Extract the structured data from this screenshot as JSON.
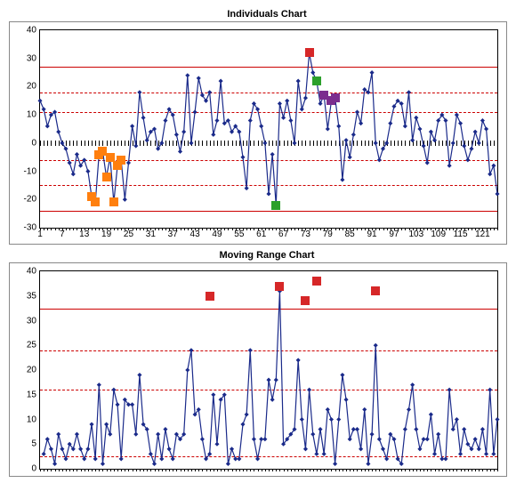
{
  "chart_data": [
    {
      "id": "individuals",
      "title": "Individuals Chart",
      "type": "line",
      "xlabel": "",
      "ylabel": "",
      "xlim": [
        1,
        125
      ],
      "ylim": [
        -30,
        40
      ],
      "y_ticks": [
        -30,
        -20,
        -10,
        0,
        10,
        20,
        30,
        40
      ],
      "x_ticks": [
        1,
        7,
        13,
        19,
        25,
        31,
        37,
        43,
        49,
        55,
        61,
        67,
        73,
        79,
        85,
        91,
        97,
        103,
        109,
        115,
        121
      ],
      "ref_lines": {
        "solid": [
          27,
          -24
        ],
        "dashed": [
          18,
          11,
          -6,
          -15
        ]
      },
      "zero_axis": 0,
      "series": [
        {
          "name": "individuals",
          "color": "#1a2a8a",
          "x": [
            1,
            2,
            3,
            4,
            5,
            6,
            7,
            8,
            9,
            10,
            11,
            12,
            13,
            14,
            15,
            16,
            17,
            18,
            19,
            20,
            21,
            22,
            23,
            24,
            25,
            26,
            27,
            28,
            29,
            30,
            31,
            32,
            33,
            34,
            35,
            36,
            37,
            38,
            39,
            40,
            41,
            42,
            43,
            44,
            45,
            46,
            47,
            48,
            49,
            50,
            51,
            52,
            53,
            54,
            55,
            56,
            57,
            58,
            59,
            60,
            61,
            62,
            63,
            64,
            65,
            66,
            67,
            68,
            69,
            70,
            71,
            72,
            73,
            74,
            75,
            76,
            77,
            78,
            79,
            80,
            81,
            82,
            83,
            84,
            85,
            86,
            87,
            88,
            89,
            90,
            91,
            92,
            93,
            94,
            95,
            96,
            97,
            98,
            99,
            100,
            101,
            102,
            103,
            104,
            105,
            106,
            107,
            108,
            109,
            110,
            111,
            112,
            113,
            114,
            115,
            116,
            117,
            118,
            119,
            120,
            121,
            122,
            123,
            124,
            125
          ],
          "values": [
            15,
            12,
            6,
            10,
            11,
            4,
            0,
            -2,
            -7,
            -11,
            -4,
            -8,
            -6,
            -10,
            -19,
            -21,
            -4,
            -3,
            -12,
            -5,
            -21,
            -8,
            -6,
            -20,
            -7,
            6,
            -1,
            18,
            9,
            1,
            4,
            5,
            -2,
            0,
            8,
            12,
            10,
            3,
            -3,
            4,
            24,
            0,
            11,
            23,
            17,
            15,
            18,
            3,
            8,
            22,
            7,
            8,
            4,
            6,
            4,
            -5,
            -16,
            8,
            14,
            12,
            6,
            0,
            -18,
            -4,
            -22,
            14,
            9,
            15,
            8,
            0,
            22,
            12,
            16,
            32,
            25,
            22,
            14,
            17,
            5,
            15,
            16,
            6,
            -13,
            1,
            -5,
            3,
            11,
            7,
            19,
            18,
            25,
            0,
            -6,
            -2,
            0,
            7,
            13,
            15,
            14,
            6,
            18,
            1,
            9,
            5,
            -1,
            -7,
            4,
            1,
            8,
            10,
            8,
            -8,
            0,
            10,
            7,
            -1,
            -6,
            -2,
            4,
            0,
            8,
            5,
            -11,
            -8,
            -18
          ]
        }
      ],
      "highlight_markers": [
        {
          "x": 15,
          "y": -19,
          "color": "orange"
        },
        {
          "x": 16,
          "y": -21,
          "color": "orange"
        },
        {
          "x": 17,
          "y": -4,
          "color": "orange"
        },
        {
          "x": 18,
          "y": -3,
          "color": "orange"
        },
        {
          "x": 19,
          "y": -12,
          "color": "orange"
        },
        {
          "x": 20,
          "y": -5,
          "color": "orange"
        },
        {
          "x": 21,
          "y": -21,
          "color": "orange"
        },
        {
          "x": 22,
          "y": -8,
          "color": "orange"
        },
        {
          "x": 23,
          "y": -6,
          "color": "orange"
        },
        {
          "x": 65,
          "y": -22,
          "color": "green"
        },
        {
          "x": 74,
          "y": 32,
          "color": "red"
        },
        {
          "x": 76,
          "y": 22,
          "color": "green"
        },
        {
          "x": 78,
          "y": 17,
          "color": "purple"
        },
        {
          "x": 80,
          "y": 15,
          "color": "purple"
        },
        {
          "x": 81,
          "y": 16,
          "color": "purple"
        }
      ]
    },
    {
      "id": "moving_range",
      "title": "Moving Range Chart",
      "type": "line",
      "xlabel": "",
      "ylabel": "",
      "xlim": [
        1,
        125
      ],
      "ylim": [
        0,
        40
      ],
      "y_ticks": [
        0,
        5,
        10,
        15,
        20,
        25,
        30,
        35,
        40
      ],
      "x_ticks_minor_only": true,
      "ref_lines": {
        "solid": [
          32.5
        ],
        "dashed": [
          24,
          16,
          2.5
        ]
      },
      "series": [
        {
          "name": "moving_range",
          "color": "#1a2a8a",
          "x": [
            2,
            3,
            4,
            5,
            6,
            7,
            8,
            9,
            10,
            11,
            12,
            13,
            14,
            15,
            16,
            17,
            18,
            19,
            20,
            21,
            22,
            23,
            24,
            25,
            26,
            27,
            28,
            29,
            30,
            31,
            32,
            33,
            34,
            35,
            36,
            37,
            38,
            39,
            40,
            41,
            42,
            43,
            44,
            45,
            46,
            47,
            48,
            49,
            50,
            51,
            52,
            53,
            54,
            55,
            56,
            57,
            58,
            59,
            60,
            61,
            62,
            63,
            64,
            65,
            66,
            67,
            68,
            69,
            70,
            71,
            72,
            73,
            74,
            75,
            76,
            77,
            78,
            79,
            80,
            81,
            82,
            83,
            84,
            85,
            86,
            87,
            88,
            89,
            90,
            91,
            92,
            93,
            94,
            95,
            96,
            97,
            98,
            99,
            100,
            101,
            102,
            103,
            104,
            105,
            106,
            107,
            108,
            109,
            110,
            111,
            112,
            113,
            114,
            115,
            116,
            117,
            118,
            119,
            120,
            121,
            122,
            123,
            124,
            125
          ],
          "values": [
            3,
            6,
            4,
            1,
            7,
            4,
            2,
            5,
            4,
            7,
            4,
            2,
            4,
            9,
            2,
            17,
            1,
            9,
            7,
            16,
            13,
            2,
            14,
            13,
            13,
            7,
            19,
            9,
            8,
            3,
            1,
            7,
            2,
            8,
            4,
            2,
            7,
            6,
            7,
            20,
            24,
            11,
            12,
            6,
            2,
            3,
            15,
            5,
            14,
            15,
            1,
            4,
            2,
            2,
            9,
            11,
            24,
            6,
            2,
            6,
            6,
            18,
            14,
            18,
            36,
            5,
            6,
            7,
            8,
            22,
            10,
            4,
            16,
            7,
            3,
            8,
            3,
            12,
            10,
            1,
            10,
            19,
            14,
            6,
            8,
            8,
            4,
            12,
            1,
            7,
            25,
            6,
            4,
            2,
            7,
            6,
            2,
            1,
            8,
            12,
            17,
            8,
            4,
            6,
            6,
            11,
            3,
            7,
            2,
            2,
            16,
            8,
            10,
            3,
            8,
            5,
            4,
            6,
            4,
            8,
            3,
            16,
            3,
            10
          ]
        }
      ],
      "highlight_markers": [
        {
          "x": 47,
          "y": 35,
          "color": "red"
        },
        {
          "x": 66,
          "y": 37,
          "color": "red"
        },
        {
          "x": 73,
          "y": 34,
          "color": "red"
        },
        {
          "x": 76,
          "y": 38,
          "color": "red"
        },
        {
          "x": 92,
          "y": 36,
          "color": "red"
        }
      ]
    }
  ]
}
